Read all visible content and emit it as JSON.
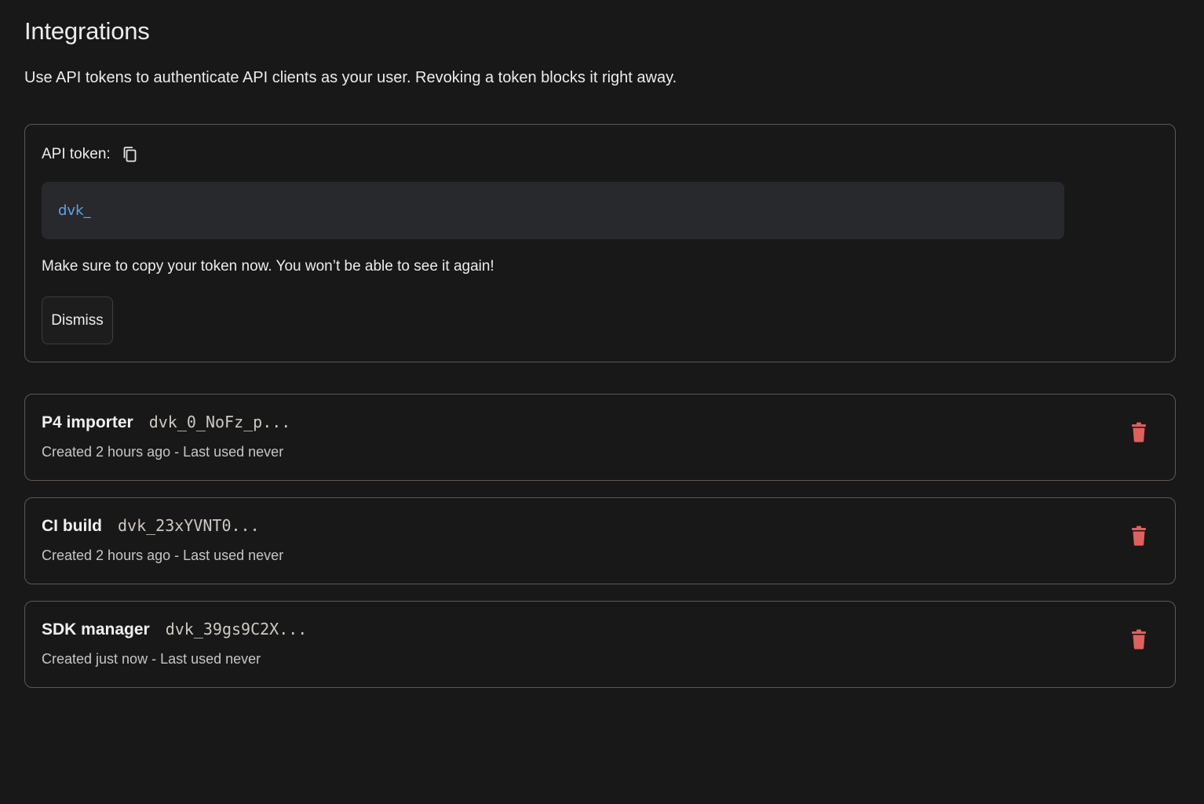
{
  "page": {
    "title": "Integrations",
    "description": "Use API tokens to authenticate API clients as your user. Revoking a token blocks it right away."
  },
  "new_token": {
    "label": "API token:",
    "copy_icon": "copy-icon",
    "value": "dvk_",
    "warning": "Make sure to copy your token now. You won’t be able to see it again!",
    "dismiss_label": "Dismiss"
  },
  "tokens": [
    {
      "name": "P4 importer",
      "prefix": "dvk_0_NoFz_p...",
      "meta": "Created 2 hours ago - Last used never",
      "delete_icon": "trash-icon"
    },
    {
      "name": "CI build",
      "prefix": "dvk_23xYVNT0...",
      "meta": "Created 2 hours ago - Last used never",
      "delete_icon": "trash-icon"
    },
    {
      "name": "SDK manager",
      "prefix": "dvk_39gs9C2X...",
      "meta": "Created just now - Last used never",
      "delete_icon": "trash-icon"
    }
  ],
  "colors": {
    "background": "#181818",
    "border": "#5f5751",
    "token_value": "#5fa3e0",
    "delete": "#e0605c"
  }
}
